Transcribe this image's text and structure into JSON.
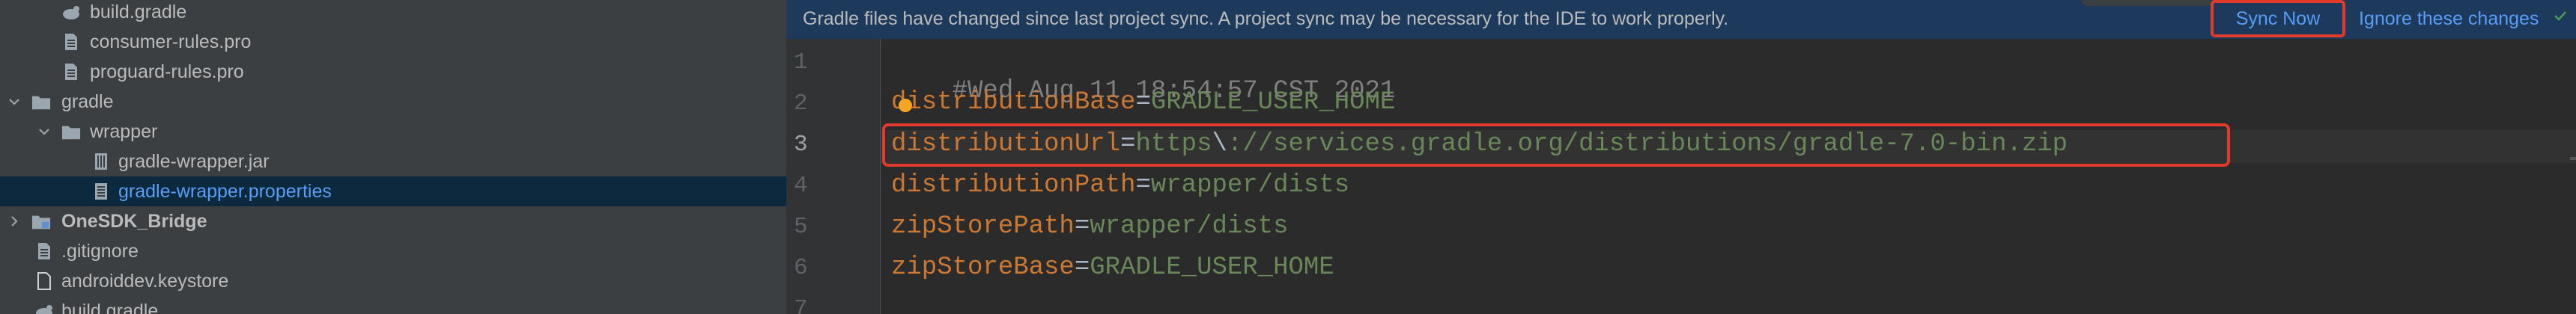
{
  "project_tree": {
    "items": [
      {
        "label": "build.gradle",
        "icon": "gradle-file-icon"
      },
      {
        "label": "consumer-rules.pro",
        "icon": "text-file-icon"
      },
      {
        "label": "proguard-rules.pro",
        "icon": "text-file-icon"
      },
      {
        "label": "gradle",
        "icon": "folder-icon"
      },
      {
        "label": "wrapper",
        "icon": "folder-icon"
      },
      {
        "label": "gradle-wrapper.jar",
        "icon": "jar-file-icon"
      },
      {
        "label": "gradle-wrapper.properties",
        "icon": "properties-file-icon"
      },
      {
        "label": "OneSDK_Bridge",
        "icon": "module-folder-icon"
      },
      {
        "label": ".gitignore",
        "icon": "text-file-icon"
      },
      {
        "label": "androiddev.keystore",
        "icon": "file-icon"
      },
      {
        "label": "build.gradle",
        "icon": "gradle-file-icon"
      }
    ]
  },
  "notification": {
    "message": "Gradle files have changed since last project sync. A project sync may be necessary for the IDE to work properly.",
    "sync_now": "Sync Now",
    "ignore": "Ignore these changes"
  },
  "editor": {
    "line_numbers": [
      "1",
      "2",
      "3",
      "4",
      "5",
      "6",
      "7"
    ],
    "lines": [
      {
        "comment": "#Wed Aug 11 18:54:57 CST 2021"
      },
      {
        "key": "distributionBase",
        "eq": "=",
        "value": "GRADLE_USER_HOME"
      },
      {
        "key": "distributionUrl",
        "eq": "=",
        "value_pre": "https",
        "escape": "\\",
        "value_post": "://services.gradle.org/distributions/gradle-7.0-bin.zip"
      },
      {
        "key": "distributionPath",
        "eq": "=",
        "value": "wrapper/dists"
      },
      {
        "key": "zipStorePath",
        "eq": "=",
        "value": "wrapper/dists"
      },
      {
        "key": "zipStoreBase",
        "eq": "=",
        "value": "GRADLE_USER_HOME"
      }
    ]
  },
  "colors": {
    "highlight_border": "#e23b2b",
    "link": "#589df6",
    "key": "#cc7832",
    "value": "#6a8759"
  }
}
